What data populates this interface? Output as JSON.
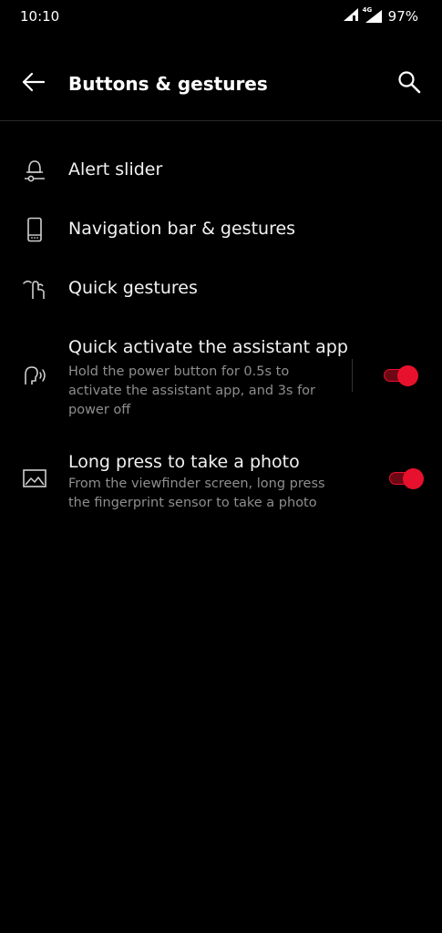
{
  "status_bar": {
    "time": "10:10",
    "network_label": "4G",
    "battery": "97%",
    "icons": [
      "signal-icon",
      "wifi-icon",
      "battery-icon"
    ]
  },
  "header": {
    "title": "Buttons & gestures",
    "back_icon": "arrow-left-icon",
    "search_icon": "search-icon"
  },
  "items": [
    {
      "title": "Alert slider",
      "icon": "alert-slider-icon"
    },
    {
      "title": "Navigation bar & gestures",
      "icon": "phone-icon"
    },
    {
      "title": "Quick gestures",
      "icon": "gesture-icon"
    },
    {
      "title": "Quick activate the assistant app",
      "subtitle": "Hold the power button for 0.5s to activate the assistant app, and 3s for power off",
      "icon": "voice-assistant-icon",
      "toggle_on": true
    },
    {
      "title": "Long press to take a photo",
      "subtitle": "From the viewfinder screen, long press the fingerprint sensor to take a photo",
      "icon": "image-icon",
      "toggle_on": true
    }
  ],
  "colors": {
    "background": "#000000",
    "accent": "#e8112d",
    "text_primary": "#f2f2f2",
    "text_secondary": "#8e8e8e"
  }
}
